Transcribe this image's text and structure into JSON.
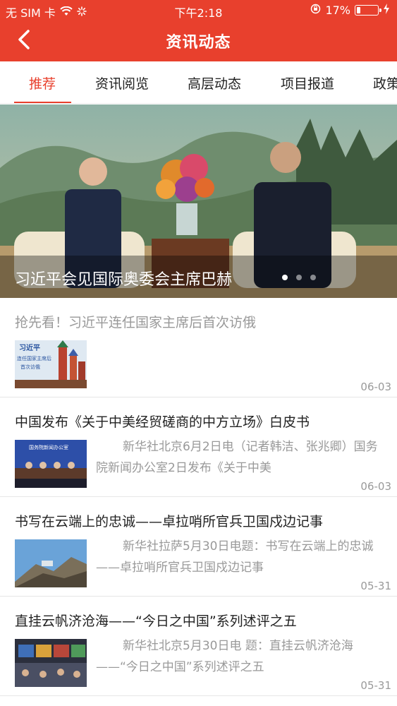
{
  "status_bar": {
    "carrier": "无 SIM 卡",
    "time": "下午2:18",
    "battery": "17%"
  },
  "header": {
    "title": "资讯动态"
  },
  "tabs": [
    {
      "label": "推荐",
      "active": true
    },
    {
      "label": "资讯阅览",
      "active": false
    },
    {
      "label": "高层动态",
      "active": false
    },
    {
      "label": "项目报道",
      "active": false
    },
    {
      "label": "政策",
      "active": false
    }
  ],
  "banner": {
    "title": "习近平会见国际奥委会主席巴赫",
    "slide_count": 3,
    "active_slide": 1
  },
  "news": [
    {
      "headline": "抢先看！习近平连任国家主席后首次访俄",
      "thumb_text": "习近平 连任国家主席后 首次访俄",
      "summary": "",
      "date": "06-03",
      "read": true
    },
    {
      "headline": "中国发布《关于中美经贸磋商的中方立场》白皮书",
      "thumb_text": "国务院新闻办公室",
      "summary": "新华社北京6月2日电（记者韩洁、张兆卿）国务院新闻办公室2日发布《关于中美",
      "date": "06-03",
      "read": false
    },
    {
      "headline": "书写在云端上的忠诚——卓拉哨所官兵卫国戍边记事",
      "thumb_text": "",
      "summary": "新华社拉萨5月30日电题：书写在云端上的忠诚——卓拉哨所官兵卫国戍边记事",
      "date": "05-31",
      "read": false
    },
    {
      "headline": "直挂云帆济沧海——“今日之中国”系列述评之五",
      "thumb_text": "",
      "summary": "新华社北京5月30日电 题：直挂云帆济沧海——“今日之中国”系列述评之五",
      "date": "05-31",
      "read": false
    }
  ],
  "colors": {
    "accent": "#e8402d",
    "text_primary": "#222222",
    "text_secondary": "#999999"
  }
}
